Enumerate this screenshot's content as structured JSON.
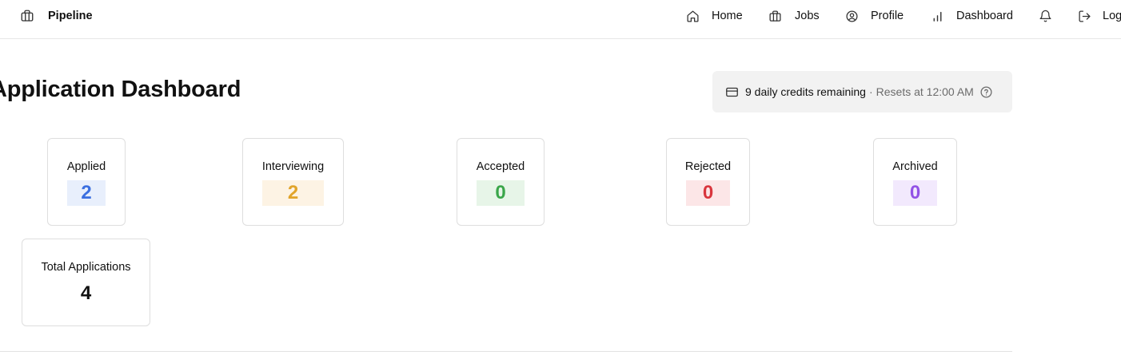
{
  "brand": {
    "name": "Pipeline",
    "icon": "briefcase-icon"
  },
  "nav": {
    "home": {
      "label": "Home",
      "icon": "home-icon"
    },
    "jobs": {
      "label": "Jobs",
      "icon": "briefcase-icon"
    },
    "profile": {
      "label": "Profile",
      "icon": "user-circle-icon"
    },
    "dashboard": {
      "label": "Dashboard",
      "icon": "bar-chart-icon"
    },
    "notifications": {
      "icon": "bell-icon"
    },
    "logout": {
      "label": "Log",
      "icon": "logout-icon"
    }
  },
  "page": {
    "title": "Application Dashboard"
  },
  "credits": {
    "main": "9 daily credits remaining",
    "separator": "·",
    "reset": "Resets at 12:00 AM",
    "icon": "credit-card-icon",
    "help_icon": "help-circle-icon"
  },
  "stats": {
    "applied": {
      "label": "Applied",
      "value": "2",
      "color": "#3b6fe0",
      "bg": "#e8effc"
    },
    "interviewing": {
      "label": "Interviewing",
      "value": "2",
      "color": "#e1a42a",
      "bg": "#fdf3e4"
    },
    "accepted": {
      "label": "Accepted",
      "value": "0",
      "color": "#3aa64a",
      "bg": "#e7f5e8"
    },
    "rejected": {
      "label": "Rejected",
      "value": "0",
      "color": "#d9363e",
      "bg": "#fce6e7"
    },
    "archived": {
      "label": "Archived",
      "value": "0",
      "color": "#9252e6",
      "bg": "#f2e9fd"
    },
    "total": {
      "label": "Total Applications",
      "value": "4"
    }
  }
}
